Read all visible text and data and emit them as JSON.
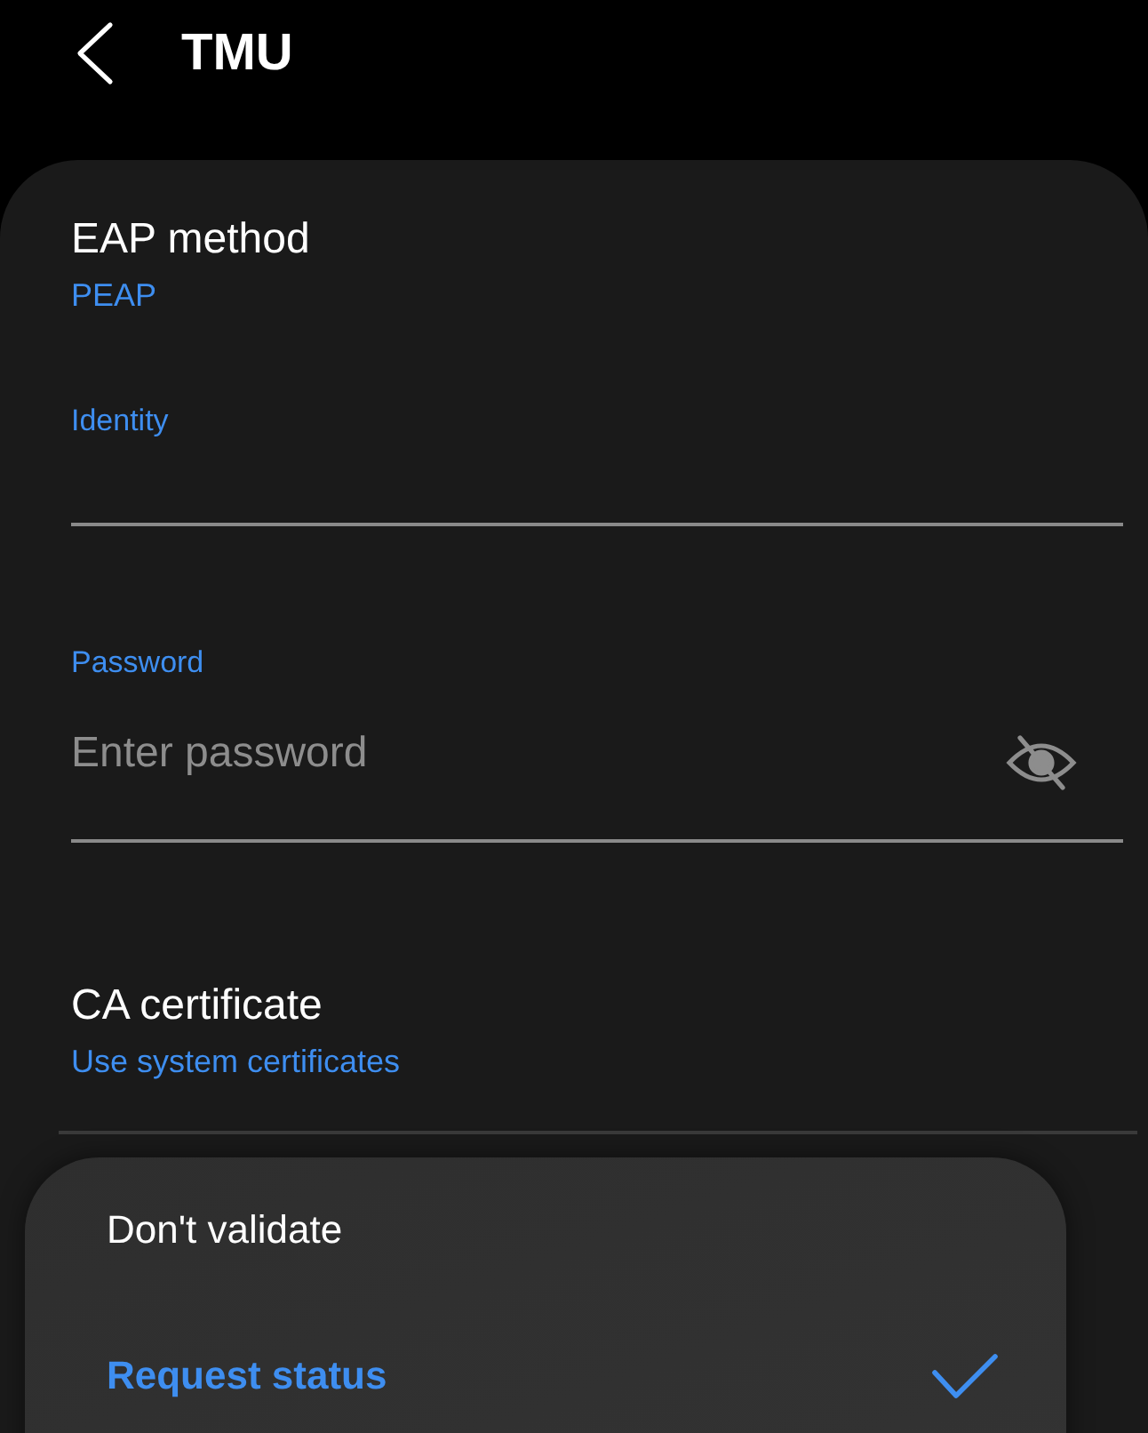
{
  "header": {
    "title": "TMU"
  },
  "eap_method": {
    "label": "EAP method",
    "value": "PEAP"
  },
  "identity": {
    "label": "Identity"
  },
  "password": {
    "label": "Password",
    "placeholder": "Enter password"
  },
  "ca_certificate": {
    "label": "CA certificate",
    "value": "Use system certificates"
  },
  "menu": {
    "items": [
      {
        "label": "Don't validate",
        "selected": false
      },
      {
        "label": "Request status",
        "selected": true
      }
    ]
  }
}
